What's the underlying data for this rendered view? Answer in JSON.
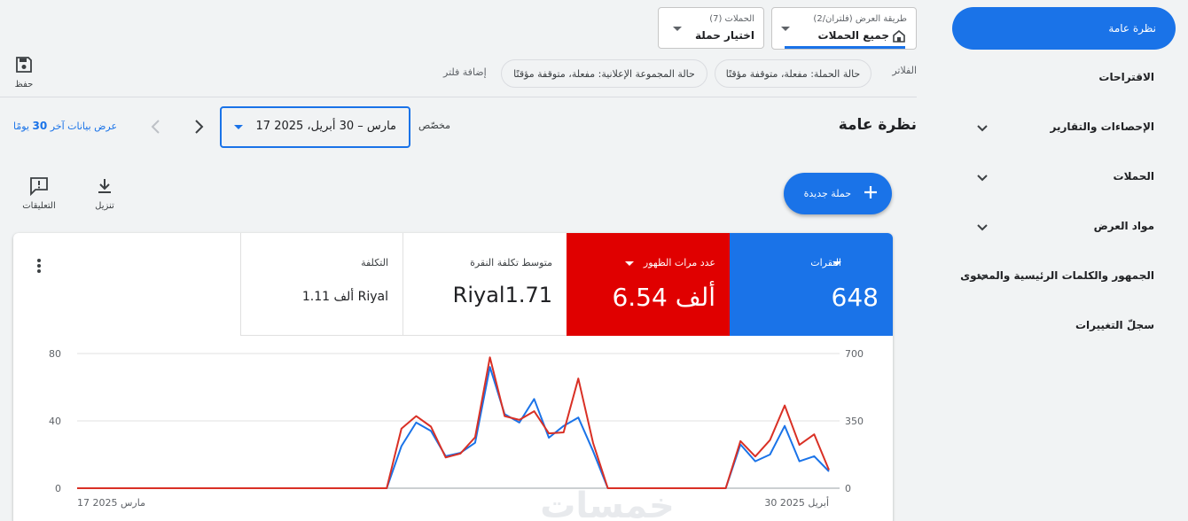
{
  "sidebar": {
    "active": "نظرة عامة",
    "items": [
      {
        "label": "الاقتراحات"
      },
      {
        "label": "الإحصاءات والتقارير"
      },
      {
        "label": "الحملات"
      },
      {
        "label": "مواد العرض"
      },
      {
        "label": "الجمهور والكلمات الرئيسية والمحتوى"
      },
      {
        "label": "سجلّ التغييرات"
      }
    ]
  },
  "view_selector": {
    "label": "طريقة العرض (فلتران/2)",
    "value": "جميع الحملات"
  },
  "campaign_selector": {
    "label": "الحملات (7)",
    "value": "اختيار حملة"
  },
  "toolbar": {
    "save_label": "حفظ",
    "download_label": "تنزيل",
    "feedback_label": "التعليقات"
  },
  "filters": {
    "label": "الفلاتر",
    "chips": [
      "حالة الحملة: مفعلة، متوقفة مؤقتًا",
      "حالة المجموعة الإعلانية: مفعلة، متوقفة مؤقتًا"
    ],
    "add_label": "إضافة فلتر"
  },
  "page_title": "نظرة عامة",
  "date": {
    "range_type": "مخصّص",
    "range": "17 مارس – 30 أبريل، 2025",
    "last30_label": "عرض بيانات آخر",
    "last30_num": "30",
    "last30_suffix": "يومًا"
  },
  "new_campaign_label": "حملة جديدة",
  "metrics": [
    {
      "label": "النقرات",
      "value": "648",
      "color": "#1a73e8"
    },
    {
      "label": "عدد مرات الظهور",
      "value": "6.54 ألف",
      "color": "#e00000"
    },
    {
      "label": "متوسط تكلفة النقرة",
      "value": "Riyal1.71"
    },
    {
      "label": "التكلفة",
      "value": "1.11 ألف Riyal"
    }
  ],
  "chart_data": {
    "type": "line",
    "x_start_label": "17 مارس 2025",
    "x_end_label": "30 أبريل 2025",
    "left_axis": {
      "ticks": [
        "80",
        "40",
        "0"
      ],
      "range": [
        0,
        80
      ]
    },
    "right_axis": {
      "ticks": [
        "700",
        "350",
        "0"
      ],
      "range": [
        0,
        700
      ]
    },
    "series": [
      {
        "name": "النقرات",
        "color": "#1a73e8",
        "axis": "left",
        "values": [
          0,
          0,
          0,
          0,
          0,
          0,
          0,
          0,
          0,
          0,
          0,
          0,
          0,
          0,
          0,
          0,
          0,
          0,
          0,
          0,
          0,
          0,
          25,
          39,
          34,
          19,
          21,
          27,
          72,
          44,
          39,
          53,
          30,
          37,
          42,
          22,
          0,
          0,
          0,
          0,
          0,
          0,
          0,
          0,
          0,
          26,
          16,
          20,
          37,
          16,
          19,
          10
        ]
      },
      {
        "name": "عدد مرات الظهور",
        "color": "#d93025",
        "axis": "right",
        "values": [
          0,
          0,
          0,
          0,
          0,
          0,
          0,
          0,
          0,
          0,
          0,
          0,
          0,
          0,
          0,
          0,
          0,
          0,
          0,
          0,
          0,
          0,
          310,
          375,
          320,
          160,
          180,
          265,
          680,
          375,
          355,
          400,
          285,
          290,
          570,
          235,
          0,
          0,
          0,
          0,
          0,
          0,
          0,
          0,
          0,
          245,
          165,
          250,
          430,
          225,
          280,
          95
        ]
      }
    ]
  },
  "watermark": "خمسات"
}
